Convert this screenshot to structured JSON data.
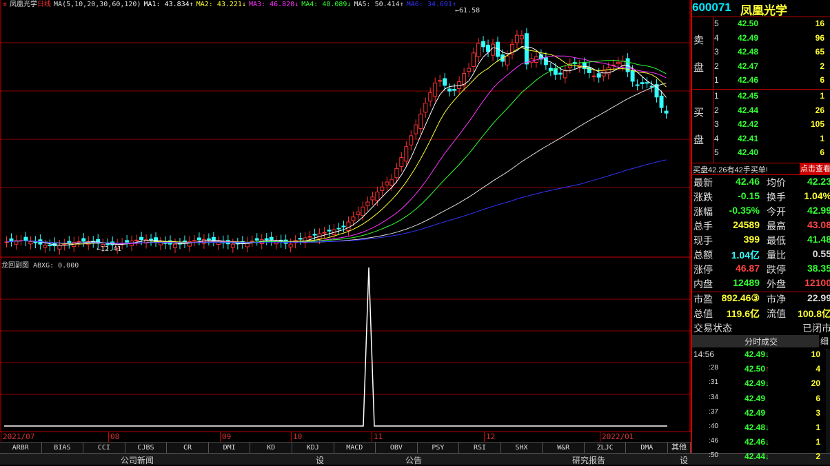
{
  "chart": {
    "name": "凤凰光学",
    "period": "日线",
    "ma_label": "MA(5,10,20,30,60,120)",
    "ma_values": [
      {
        "label": "MA1: 43.834",
        "arrow": "↑",
        "color": "#ffffff"
      },
      {
        "label": "MA2: 43.221",
        "arrow": "↓",
        "color": "#ffff33"
      },
      {
        "label": "MA3: 46.820",
        "arrow": "↓",
        "color": "#ff33ff"
      },
      {
        "label": "MA4: 48.089",
        "arrow": "↓",
        "color": "#33ff33"
      },
      {
        "label": "MA5: 50.414",
        "arrow": "↑",
        "color": "#dddddd"
      },
      {
        "label": "MA6: 34.691",
        "arrow": "↑",
        "color": "#3333ff"
      }
    ],
    "high_label": "61.58",
    "low_label": "12.41",
    "indicator_label": "龙回副图 ABXG: 0.000",
    "dates": [
      "2021/07",
      "08",
      "09",
      "10",
      "11",
      "12",
      "2022/01"
    ]
  },
  "chart_data": {
    "type": "line",
    "title": "",
    "series": [
      {
        "name": "MA5",
        "values": [
          14.0,
          14.2,
          14.5,
          15.5,
          20,
          30,
          42,
          50,
          55,
          58,
          57,
          52,
          53,
          52,
          50,
          45,
          43.8
        ]
      },
      {
        "name": "MA120",
        "values": [
          13.5,
          13.6,
          13.8,
          14.2,
          15,
          17,
          20,
          23,
          26,
          29,
          31,
          33,
          34.7
        ]
      }
    ],
    "ylim": [
      10,
      65
    ]
  },
  "tabs": [
    "ARBR",
    "BIAS",
    "CCI",
    "CJBS",
    "CR",
    "DMI",
    "KD",
    "KDJ",
    "MACD",
    "OBV",
    "PSY",
    "RSI",
    "SHX",
    "W&R",
    "ZLJC",
    "DMA",
    "其他"
  ],
  "bottom": [
    "公司新闻",
    "设",
    "公告",
    "研究报告",
    "设"
  ],
  "stock": {
    "code": "600071",
    "name": "凤凰光学"
  },
  "sell_side": "卖盘",
  "buy_side": "买盘",
  "sell_label_1": "卖",
  "sell_label_2": "盘",
  "buy_label_1": "买",
  "buy_label_2": "盘",
  "asks": [
    {
      "level": "5",
      "price": "42.50",
      "vol": "16"
    },
    {
      "level": "4",
      "price": "42.49",
      "vol": "96"
    },
    {
      "level": "3",
      "price": "42.48",
      "vol": "65"
    },
    {
      "level": "2",
      "price": "42.47",
      "vol": "2"
    },
    {
      "level": "1",
      "price": "42.46",
      "vol": "6"
    }
  ],
  "bids": [
    {
      "level": "1",
      "price": "42.45",
      "vol": "1"
    },
    {
      "level": "2",
      "price": "42.44",
      "vol": "26"
    },
    {
      "level": "3",
      "price": "42.42",
      "vol": "105"
    },
    {
      "level": "4",
      "price": "42.41",
      "vol": "1"
    },
    {
      "level": "5",
      "price": "42.40",
      "vol": "6"
    }
  ],
  "notice": {
    "text": "买盘42.26有42手买单!",
    "button": "点击查看"
  },
  "quotes": [
    {
      "k": "最新",
      "v": "42.46",
      "vc": "dn",
      "k2": "均价",
      "v2": "42.23",
      "v2c": "dn"
    },
    {
      "k": "涨跌",
      "v": "-0.15",
      "vc": "dn",
      "k2": "换手",
      "v2": "1.04%",
      "v2c": "yl"
    },
    {
      "k": "涨幅",
      "v": "-0.35%",
      "vc": "dn",
      "k2": "今开",
      "v2": "42.99",
      "v2c": "dn"
    },
    {
      "k": "总手",
      "v": "24589",
      "vc": "yl",
      "k2": "最高",
      "v2": "43.08",
      "v2c": "up"
    },
    {
      "k": "现手",
      "v": "399",
      "vc": "yl",
      "k2": "最低",
      "v2": "41.48",
      "v2c": "dn"
    },
    {
      "k": "总额",
      "v": "1.04亿",
      "vc": "cy",
      "k2": "量比",
      "v2": "0.55",
      "v2c": "wh"
    },
    {
      "k": "涨停",
      "v": "46.87",
      "vc": "up",
      "k2": "跌停",
      "v2": "38.35",
      "v2c": "dn"
    },
    {
      "k": "内盘",
      "v": "12489",
      "vc": "dn",
      "k2": "外盘",
      "v2": "12100",
      "v2c": "up"
    }
  ],
  "quotes2": [
    {
      "k": "市盈",
      "v": "892.46③",
      "vc": "yl",
      "k2": "市净",
      "v2": "22.99",
      "v2c": "wh"
    },
    {
      "k": "总值",
      "v": "119.6亿",
      "vc": "yl",
      "k2": "流值",
      "v2": "100.8亿",
      "v2c": "yl"
    }
  ],
  "trade_status": {
    "k": "交易状态",
    "v": "已闭市"
  },
  "ticks_head": {
    "title": "分时成交",
    "detail": "细"
  },
  "ticks": [
    {
      "t": "14:56",
      "p": "42.49",
      "d": "↓",
      "n": "10"
    },
    {
      "t": ":28",
      "p": "42.50",
      "d": "↑",
      "n": "4"
    },
    {
      "t": ":31",
      "p": "42.49",
      "d": "↓",
      "n": "20"
    },
    {
      "t": ":34",
      "p": "42.49",
      "d": "",
      "n": "6"
    },
    {
      "t": ":37",
      "p": "42.49",
      "d": "",
      "n": "3"
    },
    {
      "t": ":40",
      "p": "42.48",
      "d": "↓",
      "n": "1"
    },
    {
      "t": ":46",
      "p": "42.46",
      "d": "↓",
      "n": "1"
    },
    {
      "t": ":50",
      "p": "42.44",
      "d": "↓",
      "n": "2"
    }
  ]
}
